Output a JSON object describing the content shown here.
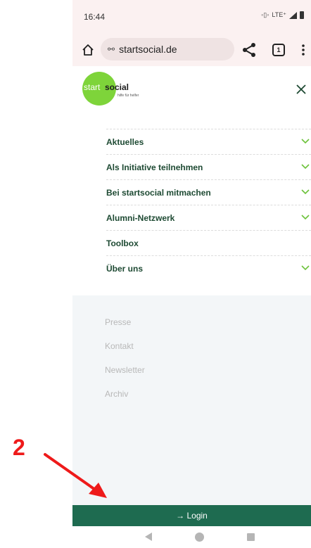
{
  "status_bar": {
    "time": "16:44",
    "network": "LTE⁺"
  },
  "browser": {
    "url": "startsocial.de",
    "tab_count": "1"
  },
  "logo": {
    "start": "start",
    "social": "social",
    "tagline": "hilfe für helfer"
  },
  "nav_items": [
    {
      "label": "Aktuelles",
      "has_chevron": true
    },
    {
      "label": "Als Initiative teilnehmen",
      "has_chevron": true
    },
    {
      "label": "Bei startsocial mitmachen",
      "has_chevron": true
    },
    {
      "label": "Alumni-Netzwerk",
      "has_chevron": true
    },
    {
      "label": "Toolbox",
      "has_chevron": false
    },
    {
      "label": "Über uns",
      "has_chevron": true
    }
  ],
  "footer_links": [
    "Presse",
    "Kontakt",
    "Newsletter",
    "Archiv"
  ],
  "login": {
    "label": "→ Login"
  },
  "annotation": {
    "step": "2"
  },
  "colors": {
    "brand_green": "#7ed43a",
    "nav_text": "#1e4a33",
    "login_bg": "#1e6b50",
    "annotation_red": "#ee1a1a"
  }
}
